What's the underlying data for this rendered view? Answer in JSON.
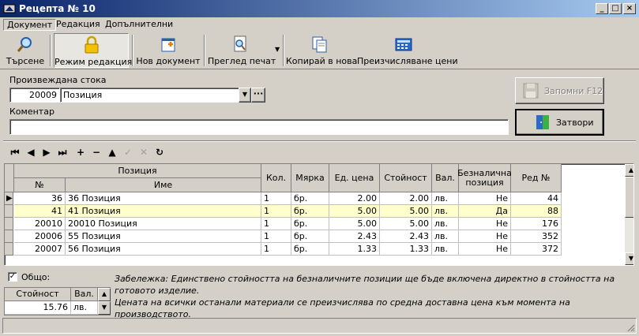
{
  "window": {
    "title": "Рецепта № 10",
    "minimize": "_",
    "maximize": "□",
    "close": "×"
  },
  "menu": [
    "Документ",
    "Редакция",
    "Допълнителни"
  ],
  "toolbar": {
    "search": "Търсене",
    "edit_mode": "Режим редакция",
    "new_doc": "Нов документ",
    "print_preview": "Преглед печат",
    "copy_new": "Копирай в нова",
    "recalc": "Преизчисляване цени"
  },
  "form": {
    "product_label": "Произвеждана стока",
    "product_code": "20009",
    "product_name": "Позиция",
    "comment_label": "Коментар",
    "comment_value": "",
    "save_button": "Запомни  F12",
    "close_button": "Затвори"
  },
  "grid": {
    "headers": {
      "position_group": "Позиция",
      "num": "№",
      "name": "Име",
      "qty": "Кол.",
      "unit": "Мярка",
      "unit_price": "Ед. цена",
      "value": "Стойност",
      "currency": "Вал.",
      "cashless_l1": "Безналична",
      "cashless_l2": "позиция",
      "row_no": "Ред №"
    },
    "rows": [
      {
        "num": "36",
        "name": "36 Позиция",
        "qty": "1",
        "unit": "бр.",
        "price": "2.00",
        "value": "2.00",
        "cur": "лв.",
        "cashless": "Не",
        "row": "44"
      },
      {
        "num": "41",
        "name": "41 Позиция",
        "qty": "1",
        "unit": "бр.",
        "price": "5.00",
        "value": "5.00",
        "cur": "лв.",
        "cashless": "Да",
        "row": "88"
      },
      {
        "num": "20010",
        "name": "20010 Позиция",
        "qty": "1",
        "unit": "бр.",
        "price": "5.00",
        "value": "5.00",
        "cur": "лв.",
        "cashless": "Не",
        "row": "176"
      },
      {
        "num": "20006",
        "name": "55 Позиция",
        "qty": "1",
        "unit": "бр.",
        "price": "2.43",
        "value": "2.43",
        "cur": "лв.",
        "cashless": "Не",
        "row": "352"
      },
      {
        "num": "20007",
        "name": "56 Позиция",
        "qty": "1",
        "unit": "бр.",
        "price": "1.33",
        "value": "1.33",
        "cur": "лв.",
        "cashless": "Не",
        "row": "372"
      }
    ],
    "highlight_color": "#ffffcc"
  },
  "totals": {
    "checkbox_label": "Общо:",
    "checked": true,
    "value_header": "Стойност",
    "currency_header": "Вал.",
    "value": "15.76",
    "currency": "лв."
  },
  "note": {
    "line1": "Забележка: Единствено стойността на безналичните позиции ще бъде включена директно в стойността на готовото изделие.",
    "line2": "Цената на всички останали материали се преизчислява по средна доставна цена към момента на производството."
  }
}
